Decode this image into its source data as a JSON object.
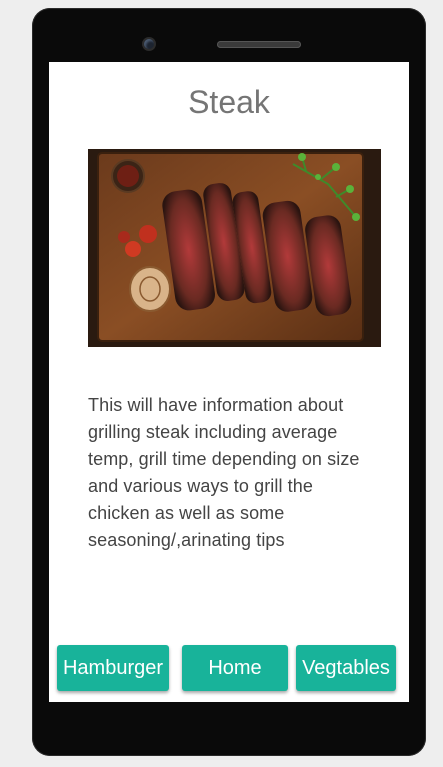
{
  "page": {
    "title": "Steak",
    "image": "steak-photo",
    "description": "This will have information about grilling steak including average temp, grill time depending on size and various ways to grill the chicken as well as some seasoning/,arinating tips"
  },
  "nav": {
    "hamburger_label": "Hamburger",
    "home_label": "Home",
    "vegtables_label": "Vegtables"
  },
  "colors": {
    "button": "#18b39a",
    "title": "#757575",
    "device": "#0a0a0a",
    "background": "#eeeeee"
  }
}
